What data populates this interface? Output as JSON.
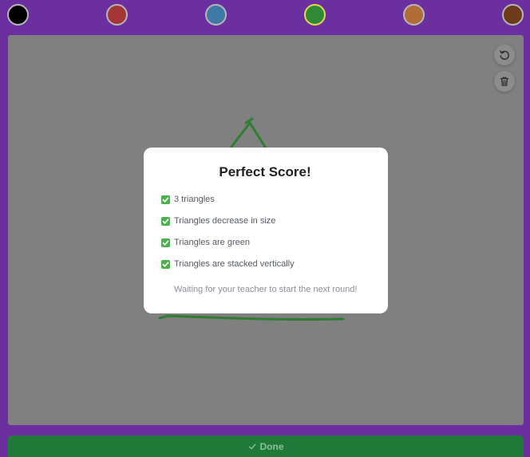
{
  "palette": {
    "colors": [
      {
        "name": "black",
        "hex": "#000000",
        "selected": false
      },
      {
        "name": "red",
        "hex": "#a33535",
        "selected": false
      },
      {
        "name": "blue",
        "hex": "#3f7aa6",
        "selected": false
      },
      {
        "name": "green",
        "hex": "#2f8a35",
        "selected": true
      },
      {
        "name": "orange",
        "hex": "#b26d37",
        "selected": false
      },
      {
        "name": "brown",
        "hex": "#6b3b1a",
        "selected": false
      }
    ]
  },
  "canvas": {
    "background": "#808080",
    "stroke_color": "#2e7d32",
    "tools": [
      {
        "name": "undo-icon"
      },
      {
        "name": "trash-icon"
      }
    ]
  },
  "modal": {
    "title": "Perfect Score!",
    "criteria": [
      "3 triangles",
      "Triangles decrease in size",
      "Triangles are green",
      "Triangles are stacked vertically"
    ],
    "status_message": "Waiting for your teacher to start the next round!"
  },
  "footer": {
    "done_label": "Done",
    "done_icon": "check-icon"
  }
}
